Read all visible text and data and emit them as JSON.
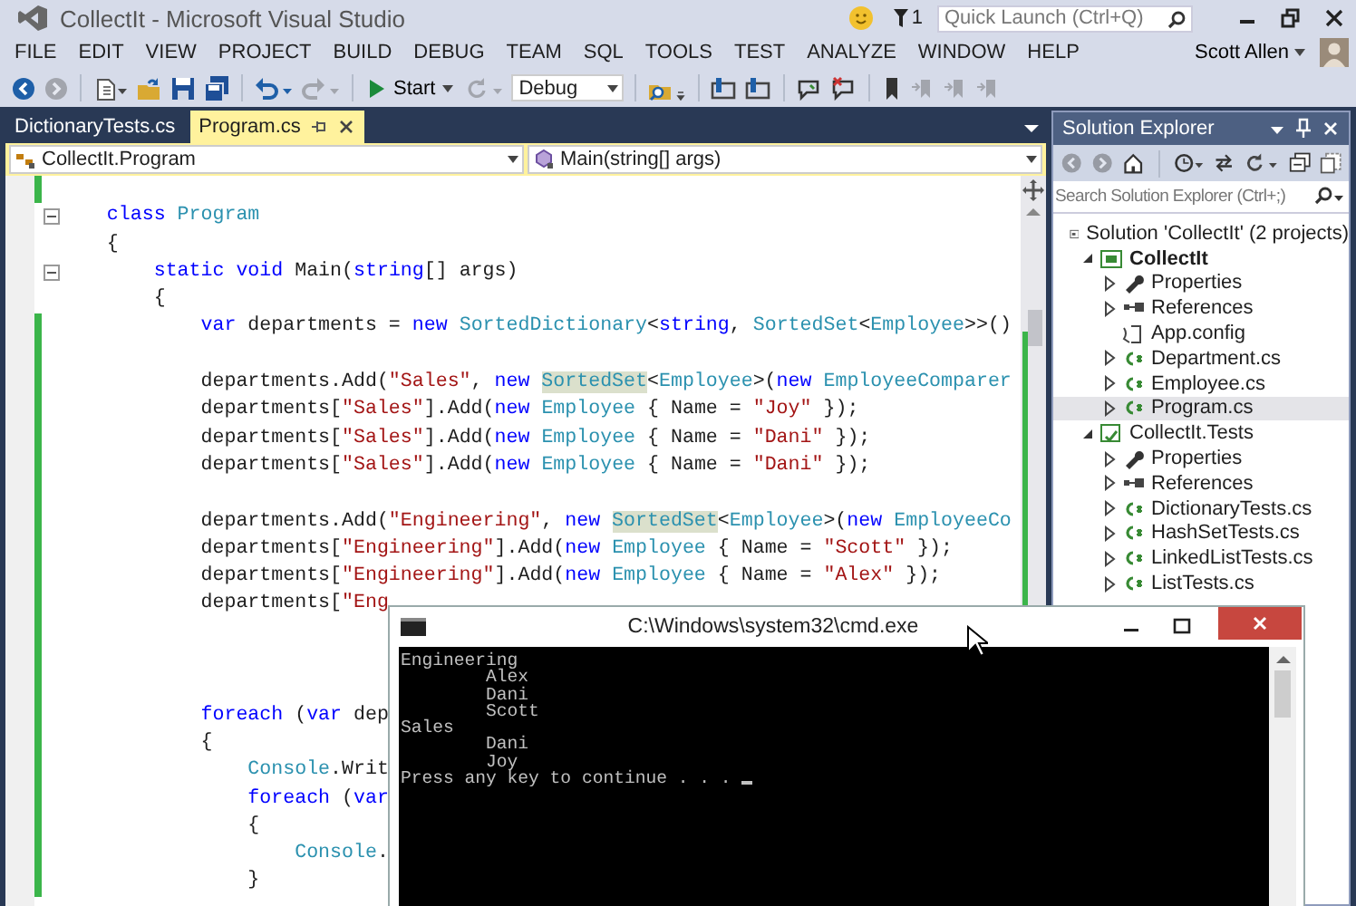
{
  "window": {
    "title": "CollectIt - Microsoft Visual Studio",
    "notification_count": "1"
  },
  "quick_launch": {
    "placeholder": "Quick Launch (Ctrl+Q)"
  },
  "menu": [
    "FILE",
    "EDIT",
    "VIEW",
    "PROJECT",
    "BUILD",
    "DEBUG",
    "TEAM",
    "SQL",
    "TOOLS",
    "TEST",
    "ANALYZE",
    "WINDOW",
    "HELP"
  ],
  "user": {
    "name": "Scott Allen"
  },
  "toolbar": [
    {
      "kind": "back",
      "disabled": false
    },
    {
      "kind": "forward",
      "disabled": true
    },
    {
      "kind": "separator"
    },
    {
      "kind": "new_item",
      "disabled": false
    },
    {
      "kind": "open",
      "disabled": false
    },
    {
      "kind": "save",
      "disabled": false
    },
    {
      "kind": "save_all",
      "disabled": false
    },
    {
      "kind": "separator"
    },
    {
      "kind": "undo",
      "disabled": false
    },
    {
      "kind": "redo",
      "disabled": true
    },
    {
      "kind": "separator"
    },
    {
      "kind": "start",
      "label": "Start",
      "disabled": false
    },
    {
      "kind": "refresh",
      "disabled": true
    },
    {
      "kind": "dropdown",
      "value": "Debug"
    },
    {
      "kind": "separator"
    },
    {
      "kind": "find",
      "disabled": false
    },
    {
      "kind": "separator"
    },
    {
      "kind": "layout",
      "disabled": false
    },
    {
      "kind": "layout",
      "disabled": false
    },
    {
      "kind": "separator"
    },
    {
      "kind": "comment",
      "disabled": false
    },
    {
      "kind": "uncomment",
      "disabled": false
    },
    {
      "kind": "separator"
    },
    {
      "kind": "bookmark",
      "disabled": false
    },
    {
      "kind": "bookmark_nav",
      "disabled": true
    },
    {
      "kind": "bookmark_nav",
      "disabled": true
    },
    {
      "kind": "bookmark_nav",
      "disabled": true
    }
  ],
  "document_tabs": [
    {
      "label": "DictionaryTests.cs",
      "selected": false
    },
    {
      "label": "Program.cs",
      "selected": true
    }
  ],
  "navigation_bar": {
    "type_scope": "CollectIt.Program",
    "member_scope": "Main(string[] args)"
  },
  "code_lines": [
    {
      "changed": true,
      "foldable": false
    },
    {
      "changed": false,
      "foldable": true,
      "tokens": [
        {
          "text": "    class",
          "kind": "keyword"
        },
        {
          "text": " Program",
          "kind": "type"
        }
      ]
    },
    {
      "changed": false,
      "foldable": false,
      "tokens": [
        {
          "text": "    {",
          "kind": "plain"
        }
      ]
    },
    {
      "changed": false,
      "foldable": true,
      "tokens": [
        {
          "text": "        static void",
          "kind": "keyword"
        },
        {
          "text": " Main(",
          "kind": "plain"
        },
        {
          "text": "string",
          "kind": "keyword"
        },
        {
          "text": "[] args)",
          "kind": "plain"
        }
      ]
    },
    {
      "changed": false,
      "foldable": false,
      "tokens": [
        {
          "text": "        {",
          "kind": "plain"
        }
      ]
    },
    {
      "changed": true,
      "foldable": false,
      "tokens": [
        {
          "text": "            var",
          "kind": "keyword"
        },
        {
          "text": " departments = ",
          "kind": "plain"
        },
        {
          "text": "new",
          "kind": "keyword"
        },
        {
          "text": " SortedDictionary",
          "kind": "type"
        },
        {
          "text": "<",
          "kind": "plain"
        },
        {
          "text": "string",
          "kind": "keyword"
        },
        {
          "text": ", ",
          "kind": "plain"
        },
        {
          "text": "SortedSet",
          "kind": "type"
        },
        {
          "text": "<",
          "kind": "plain"
        },
        {
          "text": "Employee",
          "kind": "type"
        },
        {
          "text": ">>()",
          "kind": "plain"
        }
      ]
    },
    {
      "changed": true,
      "foldable": false
    },
    {
      "changed": true,
      "foldable": false,
      "tokens": [
        {
          "text": "            departments.Add(",
          "kind": "plain"
        },
        {
          "text": "\"Sales\"",
          "kind": "string"
        },
        {
          "text": ", ",
          "kind": "plain"
        },
        {
          "text": "new ",
          "kind": "keyword"
        },
        {
          "text": "SortedSet",
          "kind": "reference"
        },
        {
          "text": "<",
          "kind": "plain"
        },
        {
          "text": "Employee",
          "kind": "type"
        },
        {
          "text": ">(",
          "kind": "plain"
        },
        {
          "text": "new",
          "kind": "keyword"
        },
        {
          "text": " EmployeeComparer",
          "kind": "type"
        }
      ]
    },
    {
      "changed": true,
      "foldable": false,
      "tokens": [
        {
          "text": "            departments[",
          "kind": "plain"
        },
        {
          "text": "\"Sales\"",
          "kind": "string"
        },
        {
          "text": "].Add(",
          "kind": "plain"
        },
        {
          "text": "new",
          "kind": "keyword"
        },
        {
          "text": " Employee",
          "kind": "type"
        },
        {
          "text": " { Name = ",
          "kind": "plain"
        },
        {
          "text": "\"Joy\"",
          "kind": "string"
        },
        {
          "text": " });",
          "kind": "plain"
        }
      ]
    },
    {
      "changed": true,
      "foldable": false,
      "tokens": [
        {
          "text": "            departments[",
          "kind": "plain"
        },
        {
          "text": "\"Sales\"",
          "kind": "string"
        },
        {
          "text": "].Add(",
          "kind": "plain"
        },
        {
          "text": "new",
          "kind": "keyword"
        },
        {
          "text": " Employee",
          "kind": "type"
        },
        {
          "text": " { Name = ",
          "kind": "plain"
        },
        {
          "text": "\"Dani\"",
          "kind": "string"
        },
        {
          "text": " });",
          "kind": "plain"
        }
      ]
    },
    {
      "changed": true,
      "foldable": false,
      "tokens": [
        {
          "text": "            departments[",
          "kind": "plain"
        },
        {
          "text": "\"Sales\"",
          "kind": "string"
        },
        {
          "text": "].Add(",
          "kind": "plain"
        },
        {
          "text": "new",
          "kind": "keyword"
        },
        {
          "text": " Employee",
          "kind": "type"
        },
        {
          "text": " { Name = ",
          "kind": "plain"
        },
        {
          "text": "\"Dani\"",
          "kind": "string"
        },
        {
          "text": " });",
          "kind": "plain"
        }
      ]
    },
    {
      "changed": true,
      "foldable": false
    },
    {
      "changed": true,
      "foldable": false,
      "tokens": [
        {
          "text": "            departments.Add(",
          "kind": "plain"
        },
        {
          "text": "\"Engineering\"",
          "kind": "string"
        },
        {
          "text": ", ",
          "kind": "plain"
        },
        {
          "text": "new ",
          "kind": "keyword"
        },
        {
          "text": "SortedSet",
          "kind": "reference"
        },
        {
          "text": "<",
          "kind": "plain"
        },
        {
          "text": "Employee",
          "kind": "type"
        },
        {
          "text": ">(",
          "kind": "plain"
        },
        {
          "text": "new",
          "kind": "keyword"
        },
        {
          "text": " EmployeeCo",
          "kind": "type"
        }
      ]
    },
    {
      "changed": true,
      "foldable": false,
      "tokens": [
        {
          "text": "            departments[",
          "kind": "plain"
        },
        {
          "text": "\"Engineering\"",
          "kind": "string"
        },
        {
          "text": "].Add(",
          "kind": "plain"
        },
        {
          "text": "new",
          "kind": "keyword"
        },
        {
          "text": " Employee",
          "kind": "type"
        },
        {
          "text": " { Name = ",
          "kind": "plain"
        },
        {
          "text": "\"Scott\"",
          "kind": "string"
        },
        {
          "text": " });",
          "kind": "plain"
        }
      ]
    },
    {
      "changed": true,
      "foldable": false,
      "tokens": [
        {
          "text": "            departments[",
          "kind": "plain"
        },
        {
          "text": "\"Engineering\"",
          "kind": "string"
        },
        {
          "text": "].Add(",
          "kind": "plain"
        },
        {
          "text": "new",
          "kind": "keyword"
        },
        {
          "text": " Employee",
          "kind": "type"
        },
        {
          "text": " { Name = ",
          "kind": "plain"
        },
        {
          "text": "\"Alex\"",
          "kind": "string"
        },
        {
          "text": " });",
          "kind": "plain"
        }
      ]
    },
    {
      "changed": true,
      "foldable": false,
      "tokens": [
        {
          "text": "            departments[",
          "kind": "plain"
        },
        {
          "text": "\"Eng",
          "kind": "string"
        }
      ]
    },
    {
      "changed": true,
      "foldable": false
    },
    {
      "changed": true,
      "foldable": false
    },
    {
      "changed": true,
      "foldable": false
    },
    {
      "changed": true,
      "foldable": false,
      "tokens": [
        {
          "text": "            foreach",
          "kind": "keyword"
        },
        {
          "text": " (",
          "kind": "plain"
        },
        {
          "text": "var",
          "kind": "keyword"
        },
        {
          "text": " dep",
          "kind": "plain"
        }
      ]
    },
    {
      "changed": true,
      "foldable": false,
      "tokens": [
        {
          "text": "            {",
          "kind": "plain"
        }
      ]
    },
    {
      "changed": true,
      "foldable": false,
      "tokens": [
        {
          "text": "                Console",
          "kind": "type"
        },
        {
          "text": ".Writ",
          "kind": "plain"
        }
      ]
    },
    {
      "changed": true,
      "foldable": false,
      "tokens": [
        {
          "text": "                foreach",
          "kind": "keyword"
        },
        {
          "text": " (",
          "kind": "plain"
        },
        {
          "text": "var",
          "kind": "keyword"
        }
      ]
    },
    {
      "changed": true,
      "foldable": false,
      "tokens": [
        {
          "text": "                {",
          "kind": "plain"
        }
      ]
    },
    {
      "changed": true,
      "foldable": false,
      "tokens": [
        {
          "text": "                    Console",
          "kind": "type"
        },
        {
          "text": ".",
          "kind": "plain"
        }
      ]
    },
    {
      "changed": true,
      "foldable": false,
      "tokens": [
        {
          "text": "                }",
          "kind": "plain"
        }
      ]
    }
  ],
  "solution_explorer": {
    "title": "Solution Explorer",
    "toolbar": [
      {
        "kind": "back",
        "disabled": true
      },
      {
        "kind": "forward",
        "disabled": true
      },
      {
        "kind": "home",
        "disabled": false
      },
      {
        "kind": "separator"
      },
      {
        "kind": "history",
        "disabled": false
      },
      {
        "kind": "switch",
        "disabled": false
      },
      {
        "kind": "refresh",
        "disabled": false
      },
      {
        "kind": "collapse",
        "disabled": false
      },
      {
        "kind": "show_all",
        "disabled": false
      }
    ],
    "search": {
      "placeholder": "Search Solution Explorer (Ctrl+;)"
    },
    "tree": [
      {
        "label": "Solution 'CollectIt' (2 projects)",
        "kind": "solution",
        "selected": false,
        "children": [
          {
            "label": "CollectIt",
            "kind": "project",
            "expanded": true,
            "selected": false,
            "children": [
              {
                "label": "Properties",
                "kind": "properties",
                "expanded": false,
                "selected": false
              },
              {
                "label": "References",
                "kind": "references",
                "expanded": false,
                "selected": false
              },
              {
                "label": "App.config",
                "kind": "config",
                "selected": false
              },
              {
                "label": "Department.cs",
                "kind": "csharp",
                "expanded": false,
                "selected": false
              },
              {
                "label": "Employee.cs",
                "kind": "csharp",
                "expanded": false,
                "selected": false
              },
              {
                "label": "Program.cs",
                "kind": "csharp",
                "expanded": false,
                "selected": true
              }
            ]
          },
          {
            "label": "CollectIt.Tests",
            "kind": "test_project",
            "expanded": true,
            "selected": false,
            "children": [
              {
                "label": "Properties",
                "kind": "properties",
                "expanded": false,
                "selected": false
              },
              {
                "label": "References",
                "kind": "references",
                "expanded": false,
                "selected": false
              },
              {
                "label": "DictionaryTests.cs",
                "kind": "csharp",
                "expanded": false,
                "selected": false
              },
              {
                "label": "HashSetTests.cs",
                "kind": "csharp",
                "expanded": false,
                "selected": false
              },
              {
                "label": "LinkedListTests.cs",
                "kind": "csharp",
                "expanded": false,
                "selected": false
              },
              {
                "label": "ListTests.cs",
                "kind": "csharp",
                "expanded": false,
                "selected": false
              }
            ]
          }
        ]
      }
    ]
  },
  "console_window": {
    "title": "C:\\Windows\\system32\\cmd.exe",
    "lines": [
      "Engineering",
      "        Alex",
      "        Dani",
      "        Scott",
      "Sales",
      "        Dani",
      "        Joy",
      "Press any key to continue . . . "
    ],
    "cursor_visible": true
  }
}
